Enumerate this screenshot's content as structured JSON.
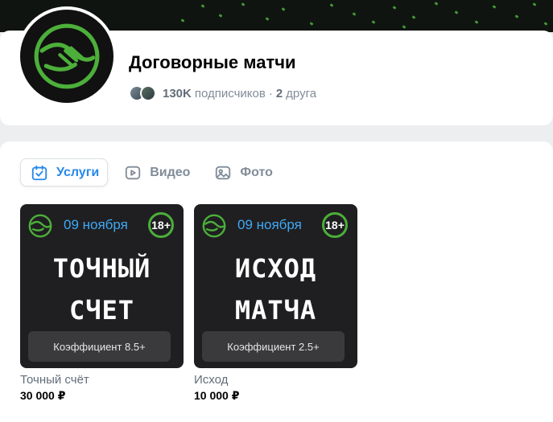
{
  "group": {
    "name": "Договорные матчи",
    "subscribers_count": "130K",
    "subscribers_label": "подписчиков",
    "separator": "·",
    "friends_count": "2",
    "friends_label": "друга"
  },
  "tabs": [
    {
      "label": "Услуги",
      "icon": "calendar-check-icon",
      "active": true
    },
    {
      "label": "Видео",
      "icon": "play-icon",
      "active": false
    },
    {
      "label": "Фото",
      "icon": "photo-icon",
      "active": false
    }
  ],
  "products": [
    {
      "date": "09 ноября",
      "age": "18+",
      "big_line1": "ТОЧНЫЙ",
      "big_line2": "СЧЕТ",
      "coefficient": "Коэффициент 8.5+",
      "title": "Точный счёт",
      "price": "30 000 ₽"
    },
    {
      "date": "09 ноября",
      "age": "18+",
      "big_line1": "ИСХОД",
      "big_line2": "МАТЧА",
      "coefficient": "Коэффициент 2.5+",
      "title": "Исход",
      "price": "10 000 ₽"
    }
  ],
  "colors": {
    "accent": "#2688eb",
    "brand_green": "#4caf3a",
    "date_blue": "#3fa9f5"
  }
}
